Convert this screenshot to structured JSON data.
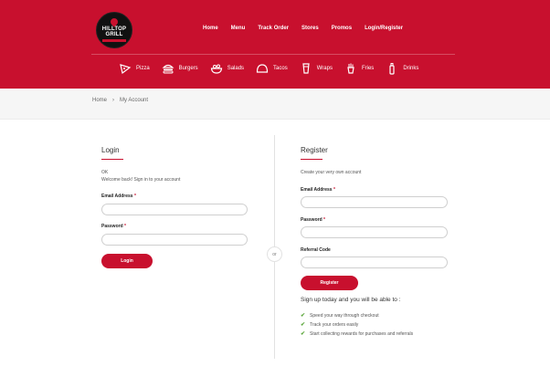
{
  "brand": {
    "line1": "HILLTOP",
    "line2": "GRILL"
  },
  "top_nav": [
    "Home",
    "Menu",
    "Track Order",
    "Stores",
    "Promos",
    "Login/Register"
  ],
  "categories": [
    {
      "label": "Pizza",
      "icon": "pizza-icon"
    },
    {
      "label": "Burgers",
      "icon": "burger-icon"
    },
    {
      "label": "Salads",
      "icon": "salad-icon"
    },
    {
      "label": "Tacos",
      "icon": "taco-icon"
    },
    {
      "label": "Wraps",
      "icon": "wrap-icon"
    },
    {
      "label": "Fries",
      "icon": "fries-icon"
    },
    {
      "label": "Drinks",
      "icon": "drink-icon"
    }
  ],
  "breadcrumb": {
    "home": "Home",
    "sep": "›",
    "current": "My Account"
  },
  "login": {
    "title": "Login",
    "status": "OK",
    "welcome": "Welcome back! Sign in to your account",
    "email_label": "Email Address",
    "password_label": "Password",
    "button": "Login"
  },
  "or_label": "or",
  "register": {
    "title": "Register",
    "subtitle": "Create your very own account",
    "email_label": "Email Address",
    "password_label": "Password",
    "referral_label": "Referral Code",
    "button": "Register",
    "benefits_title": "Sign up today and you will be able to :",
    "benefits": [
      "Speed your way through checkout",
      "Track your orders easily",
      "Start collecting rewards for purchases and referrals"
    ]
  },
  "required_mark": "*",
  "colors": {
    "brand_red": "#c8102e",
    "check_green": "#5aa63a"
  }
}
